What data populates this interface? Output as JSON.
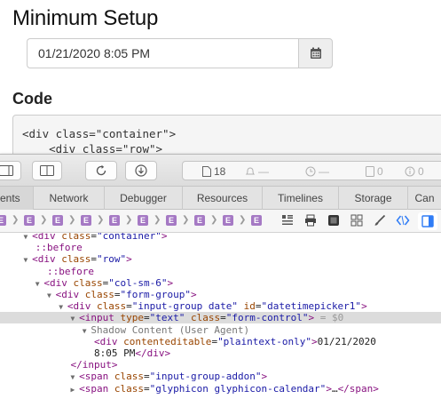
{
  "page": {
    "title": "Minimum Setup",
    "datetime_value": "01/21/2020 8:05 PM",
    "code_heading": "Code",
    "code_lines": [
      "<div class=\"container\">",
      "    <div class=\"row\">"
    ]
  },
  "toolbar": {
    "resource_count": "18",
    "warning_text": "—",
    "time_text": "—",
    "errors_count": "0",
    "warnings_count": "0"
  },
  "tabs": [
    "ents",
    "Network",
    "Debugger",
    "Resources",
    "Timelines",
    "Storage",
    "Can"
  ],
  "path_crumb_letter": "E",
  "dom_tree": {
    "lines": [
      {
        "indent": "    ",
        "tri": "▼",
        "open": "<",
        "tag": "div",
        "attrs": [
          {
            "name": "class",
            "value": "\"container\""
          }
        ],
        "close": ">",
        "partial": true
      },
      {
        "indent": "      ",
        "pseudo": "::before"
      },
      {
        "indent": "    ",
        "tri": "▼",
        "open": "<",
        "tag": "div",
        "attrs": [
          {
            "name": "class",
            "value": "\"row\""
          }
        ],
        "close": ">"
      },
      {
        "indent": "        ",
        "pseudo": "::before"
      },
      {
        "indent": "      ",
        "tri": "▼",
        "open": "<",
        "tag": "div",
        "attrs": [
          {
            "name": "class",
            "value": "\"col-sm-6\""
          }
        ],
        "close": ">"
      },
      {
        "indent": "        ",
        "tri": "▼",
        "open": "<",
        "tag": "div",
        "attrs": [
          {
            "name": "class",
            "value": "\"form-group\""
          }
        ],
        "close": ">"
      },
      {
        "indent": "          ",
        "tri": "▼",
        "open": "<",
        "tag": "div",
        "attrs": [
          {
            "name": "class",
            "value": "\"input-group date\""
          },
          {
            "name": "id",
            "value": "\"datetimepicker1\""
          }
        ],
        "close": ">"
      },
      {
        "indent": "            ",
        "tri": "▼",
        "open": "<",
        "tag": "input",
        "attrs": [
          {
            "name": "type",
            "value": "\"text\""
          },
          {
            "name": "class",
            "value": "\"form-control\""
          }
        ],
        "close": ">",
        "suffix": " = $0",
        "selected": true
      },
      {
        "indent": "              ",
        "tri": "▼",
        "shadow": "Shadow Content (User Agent)"
      },
      {
        "indent": "                ",
        "open": "<",
        "tag": "div",
        "attrs": [
          {
            "name": "contenteditable",
            "value": "\"plaintext-only\""
          }
        ],
        "close": ">",
        "text": "01/21/2020"
      },
      {
        "indent": "                ",
        "text": "8:05 PM",
        "endtag": "</div>"
      },
      {
        "indent": "            ",
        "endtag": "</input>"
      },
      {
        "indent": "            ",
        "tri": "▼",
        "open": "<",
        "tag": "span",
        "attrs": [
          {
            "name": "class",
            "value": "\"input-group-addon\""
          }
        ],
        "close": ">"
      },
      {
        "indent": "            ",
        "tri": "▶",
        "open": "<",
        "tag": "span",
        "attrs": [
          {
            "name": "class",
            "value": "\"glyphicon glyphicon-calendar\""
          }
        ],
        "close": ">",
        "ellipsis": "…",
        "endtag": "</span>"
      }
    ]
  },
  "colors": {
    "tag": "#881280",
    "attr_name": "#994500",
    "attr_value": "#1a1aa6",
    "crumb": "#a579c4",
    "active_blue": "#2f7cf6"
  }
}
